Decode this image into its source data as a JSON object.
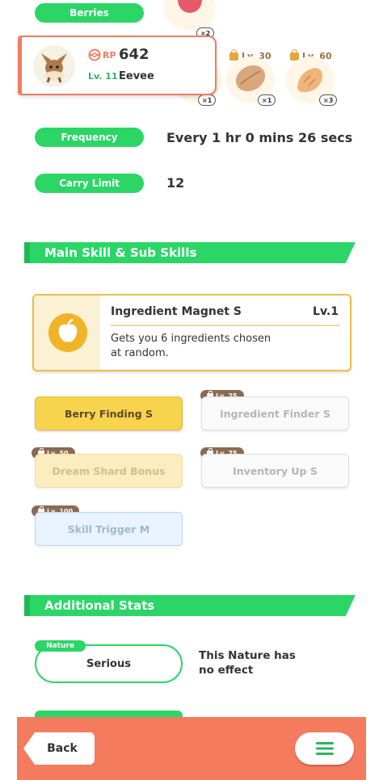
{
  "berries": {
    "label": "Berries",
    "qty": "×2"
  },
  "pokemon": {
    "rp_label": "RP",
    "rp_value": "642",
    "level": "Lv. 11",
    "name": "Eevee",
    "ingredients": [
      {
        "name": "apple",
        "qty": "×1",
        "lock": ""
      },
      {
        "name": "cacao",
        "qty": "×1",
        "lock": "Lv. 30"
      },
      {
        "name": "ginger",
        "qty": "×3",
        "lock": "Lv. 60"
      }
    ]
  },
  "frequency": {
    "label": "Frequency",
    "value": "Every 1 hr 0 mins 26 secs"
  },
  "carry_limit": {
    "label": "Carry Limit",
    "value": "12"
  },
  "main_skill_section": {
    "title": "Main Skill & Sub Skills"
  },
  "main_skill": {
    "name": "Ingredient Magnet S",
    "level": "Lv.1",
    "desc_line1": "Gets you 6 ingredients chosen",
    "desc_line2": "at random."
  },
  "sub_skills": [
    {
      "label": "Berry Finding S",
      "lock": ""
    },
    {
      "label": "Ingredient Finder S",
      "lock": "Lv. 25"
    },
    {
      "label": "Dream Shard Bonus",
      "lock": "Lv. 50"
    },
    {
      "label": "Inventory Up S",
      "lock": "Lv. 75"
    },
    {
      "label": "Skill Trigger M",
      "lock": "Lv. 100"
    }
  ],
  "additional_section": {
    "title": "Additional Stats"
  },
  "nature": {
    "tag": "Nature",
    "value": "Serious",
    "effect_line1": "This Nature has",
    "effect_line2": "no effect"
  },
  "nav": {
    "back_label": "Back",
    "menu_icon": "hamburger-menu-icon"
  }
}
